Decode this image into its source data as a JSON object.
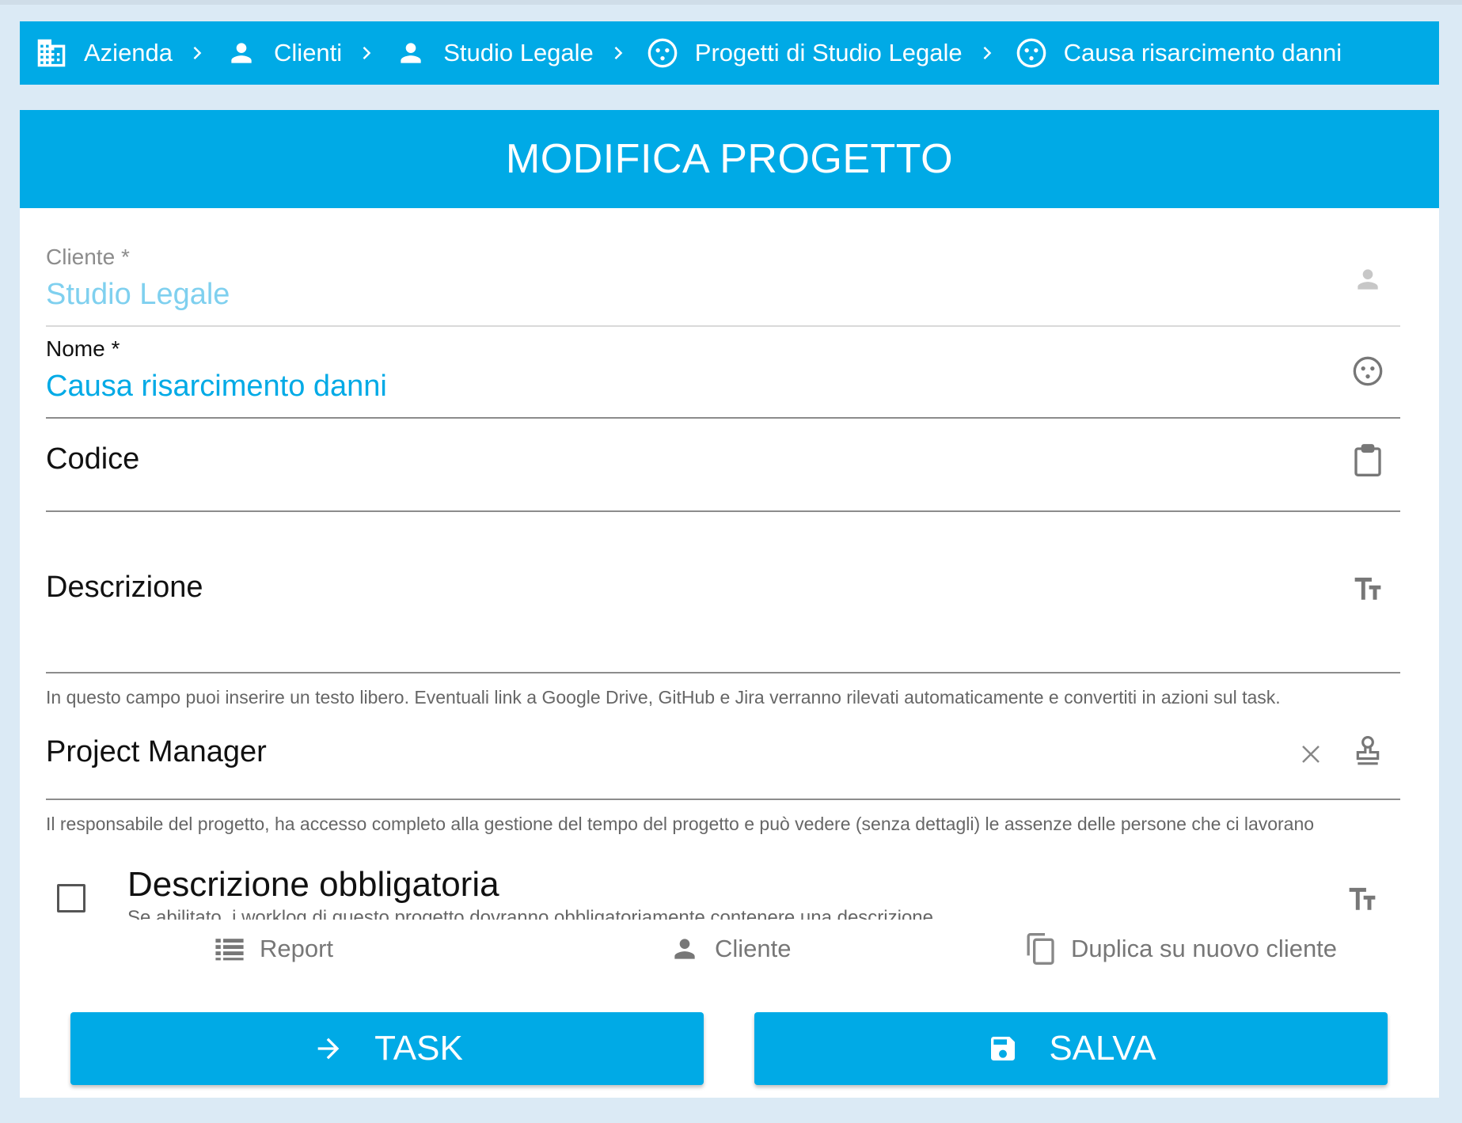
{
  "breadcrumb": {
    "items": [
      {
        "label": "Azienda",
        "icon": "building-icon"
      },
      {
        "label": "Clienti",
        "icon": "person-icon"
      },
      {
        "label": "Studio Legale",
        "icon": "person-icon"
      },
      {
        "label": "Progetti di Studio Legale",
        "icon": "project-icon"
      },
      {
        "label": "Causa risarcimento danni",
        "icon": "project-icon"
      }
    ]
  },
  "header": {
    "title": "MODIFICA PROGETTO"
  },
  "form": {
    "cliente": {
      "label": "Cliente  *",
      "value": "Studio Legale"
    },
    "nome": {
      "label": "Nome  *",
      "value": "Causa risarcimento danni"
    },
    "codice": {
      "label": "Codice",
      "value": ""
    },
    "descrizione": {
      "label": "Descrizione",
      "hint": "In questo campo puoi inserire un testo libero. Eventuali link a Google Drive, GitHub e Jira verranno rilevati automaticamente e convertiti in azioni sul task."
    },
    "project_manager": {
      "label": "Project Manager",
      "hint": "Il responsabile del progetto, ha accesso completo alla gestione del tempo del progetto e può vedere (senza dettagli) le assenze delle persone che ci lavorano"
    },
    "descrizione_obbligatoria": {
      "label": "Descrizione obbligatoria",
      "sub": "Se abilitato, i worklog di questo progetto dovranno obbligatoriamente contenere una descrizione",
      "checked": false
    }
  },
  "actions": {
    "report": "Report",
    "cliente": "Cliente",
    "duplica": "Duplica su nuovo cliente"
  },
  "buttons": {
    "task": "TASK",
    "salva": "SALVA"
  },
  "colors": {
    "accent": "#00aae6",
    "background": "#dbeaf5",
    "disabled_value": "#7fd0ef"
  }
}
